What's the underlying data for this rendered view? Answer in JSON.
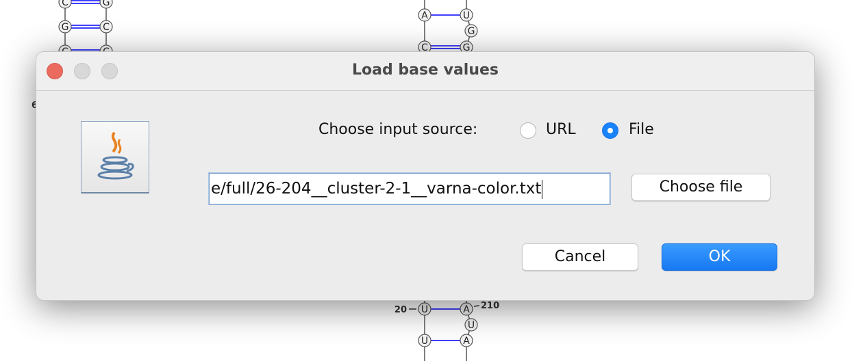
{
  "background": {
    "nucleotides_left": [
      [
        "C",
        "G"
      ],
      [
        "G",
        "C"
      ],
      [
        "C",
        "C"
      ]
    ],
    "nucleotides_top": {
      "pair1": [
        "A",
        "U"
      ],
      "bulge": "G",
      "pair2": [
        "C",
        "G"
      ]
    },
    "nucleotides_bottom": {
      "pair1": [
        "U",
        "A"
      ],
      "bulge": "U",
      "pair2": [
        "U",
        "A"
      ]
    },
    "index_labels": {
      "left": "20",
      "right": "210",
      "partial": "6"
    },
    "bond_color": "#0000ff"
  },
  "dialog": {
    "title": "Load base values",
    "icon": "java-icon",
    "source_label": "Choose input source:",
    "options": [
      {
        "label": "URL",
        "selected": false
      },
      {
        "label": "File",
        "selected": true
      }
    ],
    "file_path": "e/full/26-204__cluster-2-1__varna-color.txt",
    "choose_file_label": "Choose file",
    "cancel_label": "Cancel",
    "ok_label": "OK",
    "accent_color": "#1a82fb"
  }
}
